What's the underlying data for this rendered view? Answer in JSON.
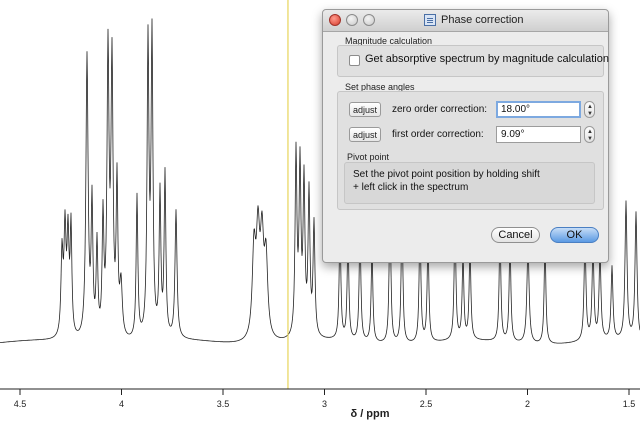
{
  "spectrum": {
    "x_axis_label": "δ / ppm",
    "ticks": [
      "4.5",
      "4",
      "3.5",
      "3",
      "2.5",
      "2",
      "1.5"
    ],
    "tick_ppm": [
      4.5,
      4.0,
      3.5,
      3.0,
      2.5,
      2.0,
      1.5
    ],
    "pivot_ppm": 3.18,
    "colors": {
      "line": "#222222",
      "pivot": "#e8d45a",
      "axis": "#222222"
    }
  },
  "dialog": {
    "title": "Phase correction",
    "icon": "table-window-icon",
    "magnitude": {
      "section_label": "Magnitude calculation",
      "checkbox_label": "Get absorptive spectrum by magnitude calculation",
      "checked": false
    },
    "phase": {
      "section_label": "Set phase angles",
      "zero_order": {
        "adjust_label": "adjust",
        "label": "zero order correction:",
        "value": "18.00°"
      },
      "first_order": {
        "adjust_label": "adjust",
        "label": "first order correction:",
        "value": "9.09°"
      }
    },
    "pivot": {
      "section_label": "Pivot point",
      "hint_line1": "Set the pivot point position by holding shift",
      "hint_line2": "+ left click in the spectrum"
    },
    "buttons": {
      "cancel": "Cancel",
      "ok": "OK"
    },
    "colors": {
      "ok_button": "#5b9ae3",
      "close_light": "#d63a2a",
      "focus_ring": "#7da9e0"
    }
  }
}
